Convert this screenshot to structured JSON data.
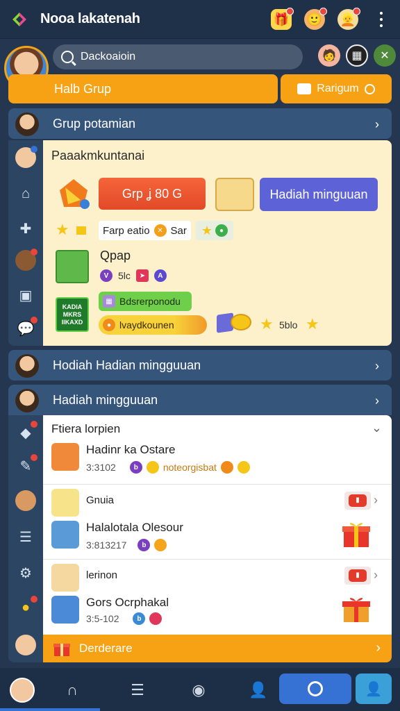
{
  "app": {
    "title": "Nooa lakatenah"
  },
  "search": {
    "placeholder": "Dackoaioin"
  },
  "buttons": {
    "group": "Halb Grup",
    "ranking": "Rarigum"
  },
  "sections": {
    "group_section": "Grup potamian",
    "weekly_reward": "Hodiah Hadian mingguuan",
    "weekly_list": "Hadiah mingguuan"
  },
  "card1": {
    "title": "Paaakmkuntanai",
    "group_button": "Grp ʝ 80 G",
    "weekly_button": "Hadiah minguuan",
    "pill_text": "Farp eatio",
    "pill_suffix": "Sar",
    "group_name": "Qpap",
    "group_meta": "5lc",
    "green_pill": "Bdsrerponodu",
    "yellow_pill": "lvaydkounen",
    "stars_value": "5blo",
    "green_box_lines": [
      "KADIA",
      "MKRS",
      "IIKAXD"
    ]
  },
  "list": {
    "title": "Ftiera lorpien",
    "items": [
      {
        "name": "Hadinr ka Ostare",
        "time": "3:3102",
        "extra": "noteorgisbat"
      },
      {
        "name": "Gnuia",
        "time": ""
      },
      {
        "name": "Halalotala Olesour",
        "time": "3:813217"
      },
      {
        "name": "lerinon",
        "time": ""
      },
      {
        "name": "Gors Ocrphakal",
        "time": "3:5-102"
      }
    ]
  },
  "footer_bar": {
    "label": "Derderare"
  },
  "colors": {
    "accent_orange": "#f7a215",
    "primary_blue": "#3572d4",
    "header_blue": "#35557a",
    "card_cream": "#fdf1cc"
  }
}
